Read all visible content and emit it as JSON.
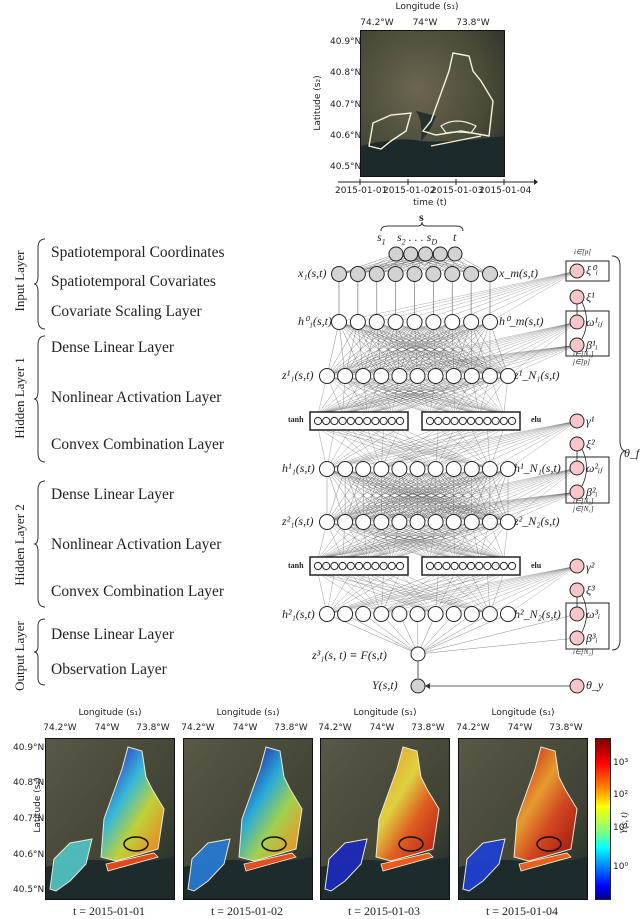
{
  "top_map": {
    "x_axis_label": "Longitude (s₁)",
    "x_ticks": [
      "74.2°W",
      "74°W",
      "73.8°W"
    ],
    "y_axis_label": "Latitude (s₂)",
    "y_ticks": [
      "40.9°N",
      "40.8°N",
      "40.7°N",
      "40.6°N",
      "40.5°N"
    ],
    "time_axis_label": "time (t)",
    "time_ticks": [
      "2015-01-01",
      "2015-01-02",
      "2015-01-03",
      "2015-01-04"
    ]
  },
  "layer_groups": [
    {
      "name": "Input Layer",
      "items": [
        "Spatiotemporal Coordinates",
        "Spatiotemporal Covariates",
        "Covariate Scaling Layer"
      ]
    },
    {
      "name": "Hidden Layer 1",
      "items": [
        "Dense Linear Layer",
        "Nonlinear Activation Layer",
        "Convex Combination Layer"
      ]
    },
    {
      "name": "Hidden Layer 2",
      "items": [
        "Dense Linear Layer",
        "Nonlinear Activation Layer",
        "Convex Combination Layer"
      ]
    },
    {
      "name": "Output Layer",
      "items": [
        "Dense Linear Layer",
        "Observation Layer"
      ]
    }
  ],
  "network": {
    "s_brace_label": "s",
    "coord_labels": [
      "s₁",
      "s₂ . . . s_D",
      "t"
    ],
    "coord_label_s1": "s",
    "coord_label_s2": "s",
    "coord_label_sd": "s",
    "coord_label_t": "t",
    "row_labels": {
      "x_left": "x₁(s,t)",
      "x_right": "x_m(s,t)",
      "h0_left": "h⁰₁(s,t)",
      "h0_right": "h⁰_m(s,t)",
      "z1_left": "z¹₁(s,t)",
      "z1_right": "z¹_N₁(s,t)",
      "h1_left": "h¹₁(s,t)",
      "h1_right": "h¹_N₁(s,t)",
      "z2_left": "z²₁(s,t)",
      "z2_right": "z²_N₂(s,t)",
      "h2_left": "h²₁(s,t)",
      "h2_right": "h²_N₂(s,t)",
      "output": "z³₁(s, t) ≡ F(s,t)",
      "observation": "Y(s,t)"
    },
    "activation_left": "tanh",
    "activation_right": "elu",
    "param_labels": {
      "xi0": "ξ⁰ᵢ",
      "xi1": "ξ¹",
      "omega1": "ω¹ᵢⱼ",
      "beta1": "β¹ᵢ",
      "gamma1": "γ¹",
      "xi2": "ξ²",
      "omega2": "ω²ᵢⱼ",
      "beta2": "β²ᵢ",
      "gamma2": "γ²",
      "xi3": "ξ³",
      "omega3": "ω³ᵢ",
      "beta3": "β³ᵢ",
      "theta_y": "θ_y",
      "theta_f": "θ_f"
    },
    "plate_labels": {
      "p0": "i∈[p]",
      "p1a": "i∈[N₁]",
      "p1b": "j∈[p]",
      "p2a": "i∈[N₂]",
      "p2b": "j∈[N₁]",
      "p3": "i∈[N₂]"
    },
    "colors": {
      "covariate_node": "#d3d3d3",
      "hidden_node": "#ffffff",
      "param_node": "#f7c6c6",
      "edge": "#555555"
    }
  },
  "bottom_maps": {
    "x_axis_label": "Longitude (s₁)",
    "x_ticks": [
      "74.2°W",
      "74°W",
      "73.8°W"
    ],
    "y_axis_label": "Latitude (s₂)",
    "y_ticks": [
      "40.9°N",
      "40.8°N",
      "40.7°N",
      "40.6°N",
      "40.5°N"
    ],
    "panels": [
      {
        "caption": "t = 2015-01-01"
      },
      {
        "caption": "t = 2015-01-02"
      },
      {
        "caption": "t = 2015-01-03"
      },
      {
        "caption": "t = 2015-01-04"
      }
    ],
    "colorbar": {
      "label": "Y(s, t)",
      "ticks": [
        "10³",
        "10²",
        "10¹",
        "10⁰"
      ],
      "colormap": "jet",
      "scale": "log"
    }
  }
}
